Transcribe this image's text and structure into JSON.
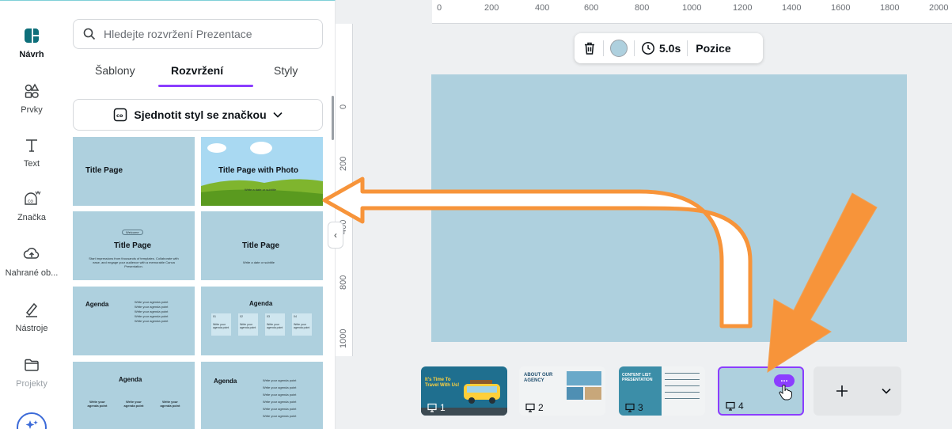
{
  "rail": {
    "items": [
      {
        "label": "Návrh",
        "icon": "design-icon"
      },
      {
        "label": "Prvky",
        "icon": "elements-icon"
      },
      {
        "label": "Text",
        "icon": "text-icon"
      },
      {
        "label": "Značka",
        "icon": "brand-icon"
      },
      {
        "label": "Nahrané ob...",
        "icon": "uploads-icon"
      },
      {
        "label": "Nástroje",
        "icon": "tools-icon"
      },
      {
        "label": "Projekty",
        "icon": "projects-icon"
      }
    ]
  },
  "panel": {
    "search_placeholder": "Hledejte rozvržení Prezentace",
    "tabs": [
      "Šablony",
      "Rozvržení",
      "Styly"
    ],
    "active_tab": "Rozvržení",
    "brand_button": "Sjednotit styl se značkou",
    "templates": {
      "t1": {
        "title": "Title Page"
      },
      "t2": {
        "title": "Title Page with Photo",
        "sub": "Write a date or subtitle"
      },
      "t3": {
        "badge": "Welcome",
        "title": "Title Page",
        "sub": "Start impressions from thousands of templates. Collaborate with ease, and engage your audience with a memorable Canva Presentation."
      },
      "t4": {
        "title": "Title Page",
        "sub": "Write a date or subtitle"
      },
      "t5": {
        "title": "Agenda",
        "bullets": [
          "Write your agenda point",
          "Write your agenda point",
          "Write your agenda point",
          "Write your agenda point",
          "Write your agenda point"
        ]
      },
      "t6": {
        "title": "Agenda",
        "nums": [
          "01",
          "02",
          "03",
          "04"
        ],
        "box_text": "Write your agenda point"
      },
      "t7": {
        "title": "Agenda",
        "cols": [
          "Write your agenda point",
          "Write your agenda point",
          "Write your agenda point"
        ]
      },
      "t8": {
        "title": "Agenda",
        "bullets": [
          "Write your agenda point",
          "Write your agenda point",
          "Write your agenda point",
          "Write your agenda point",
          "Write your agenda point",
          "Write your agenda point"
        ]
      }
    }
  },
  "ruler": {
    "top": [
      "0",
      "200",
      "400",
      "600",
      "800",
      "1000",
      "1200",
      "1400",
      "1600",
      "1800",
      "2000"
    ],
    "left": [
      "0",
      "200",
      "400",
      "600",
      "800",
      "1000"
    ]
  },
  "toolbar": {
    "duration": "5.0s",
    "position": "Pozice",
    "color": "#aed0de"
  },
  "filmstrip": {
    "thumbs": [
      {
        "num": "1",
        "headline": "It's Time To Travel With Us!"
      },
      {
        "num": "2",
        "headline": "ABOUT OUR AGENCY"
      },
      {
        "num": "3",
        "headline": "CONTENT LIST PRESENTATION"
      },
      {
        "num": "4",
        "headline": ""
      }
    ],
    "more_label": "..."
  },
  "colors": {
    "accent": "#8b3dff",
    "slide_bg": "#aed0de",
    "arrow_orange": "#f7943a"
  }
}
